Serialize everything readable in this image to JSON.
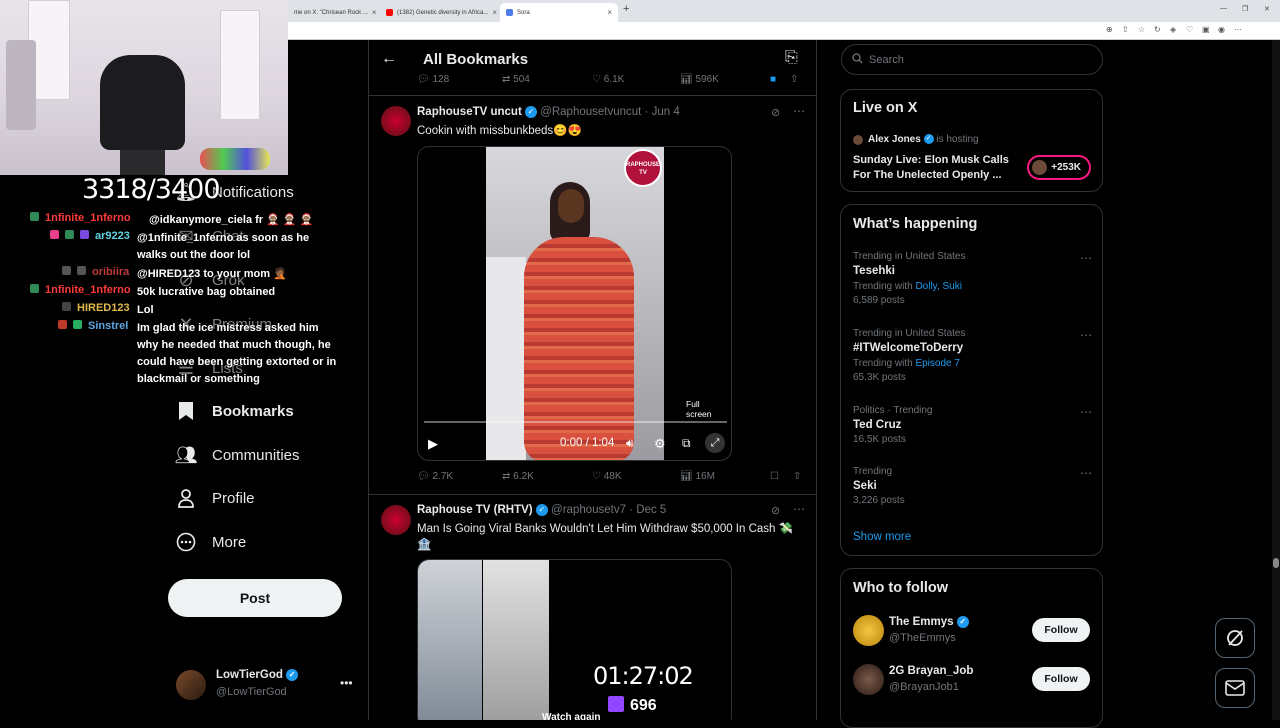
{
  "browser": {
    "tabs": [
      {
        "label": "me on X: \"Chrisean Rock ...",
        "color": "#1d9bf0"
      },
      {
        "label": "(1382) Genetic diversity in Africa...",
        "color": "#ff0000"
      },
      {
        "label": "Sora",
        "color": "#4b7bec"
      }
    ]
  },
  "stream": {
    "counter": "3318/3400",
    "chat": [
      {
        "user": "1nfinite_1nferno",
        "ucolor": "#ff3b3b",
        "msg": "@idkanymore_ciela fr 🤶🏾 🤶🏾 🤶🏾"
      },
      {
        "user": "ar9223",
        "ucolor": "#5fd3e0",
        "msg": "@1nfinite_1nferno as soon as he walks out the door lol"
      },
      {
        "user": "oribiira",
        "ucolor": "#c13b3b",
        "msg": "@HIRED123 to your mom 🤦🏾"
      },
      {
        "user": "1nfinite_1nferno",
        "ucolor": "#ff3b3b",
        "msg": "50k lucrative bag obtained"
      },
      {
        "user": "HIRED123",
        "ucolor": "#e0b94b",
        "msg": "Lol"
      },
      {
        "user": "Sinstrel",
        "ucolor": "#5fa6e0",
        "msg": "Im glad the ice mistress asked him why he needed that much though, he could have been getting extorted or in blackmail or something"
      }
    ]
  },
  "nav": {
    "items": [
      {
        "label": "Notifications"
      },
      {
        "label": "Chat"
      },
      {
        "label": "Grok"
      },
      {
        "label": "Premium"
      },
      {
        "label": "Lists"
      },
      {
        "label": "Bookmarks"
      },
      {
        "label": "Communities"
      },
      {
        "label": "Profile"
      },
      {
        "label": "More"
      }
    ],
    "post_label": "Post",
    "user_name": "LowTierGod",
    "user_handle": "@LowTierGod"
  },
  "header": {
    "title": "All Bookmarks"
  },
  "top_stats": {
    "replies": "128",
    "reposts": "504",
    "likes": "6.1K",
    "views": "596K"
  },
  "tweets": [
    {
      "name": "RaphouseTV uncut",
      "handle": "@Raphousetvuncut",
      "date": "· Jun 4",
      "text": "Cookin with missbunkbeds😊😍",
      "video": {
        "time": "0:00 / 1:04",
        "tooltip": "Full screen",
        "watermark": "RAPHOUSE TV"
      },
      "stats": {
        "replies": "2.7K",
        "reposts": "6.2K",
        "likes": "48K",
        "views": "16M"
      }
    },
    {
      "name": "Raphouse TV (RHTV)",
      "handle": "@raphousetv7",
      "date": "· Dec 5",
      "text": "Man Is Going Viral Banks Wouldn't Let Him Withdraw $50,000 In Cash 💸🏦",
      "video": {
        "overlay_time": "01:27:02",
        "viewer_count": "696",
        "watch_again": "Watch again"
      }
    }
  ],
  "search": {
    "placeholder": "Search"
  },
  "live": {
    "title": "Live on X",
    "host": "Alex Jones",
    "hosting": "is hosting",
    "desc": "Sunday Live: Elon Musk Calls For The Unelected Openly ...",
    "count": "+253K"
  },
  "happening": {
    "title": "What’s happening",
    "trends": [
      {
        "meta": "Trending in United States",
        "name": "Tesehki",
        "with_label": "Trending with",
        "with": "Dolly, Suki",
        "posts": "6,589 posts"
      },
      {
        "meta": "Trending in United States",
        "name": "#ITWelcomeToDerry",
        "with_label": "Trending with",
        "with": "Episode 7",
        "posts": "65.3K posts"
      },
      {
        "meta": "Politics · Trending",
        "name": "Ted Cruz",
        "with_label": "",
        "with": "",
        "posts": "16.5K posts"
      },
      {
        "meta": "Trending",
        "name": "Seki",
        "with_label": "",
        "with": "",
        "posts": "3,226 posts"
      }
    ],
    "show_more": "Show more"
  },
  "who": {
    "title": "Who to follow",
    "accounts": [
      {
        "name": "The Emmys",
        "handle": "@TheEmmys",
        "button": "Follow"
      },
      {
        "name": "2G Brayan_Job",
        "handle": "@BrayanJob1",
        "button": "Follow"
      }
    ]
  },
  "colors": {
    "accent": "#1d9bf0",
    "background": "#000000",
    "border": "#2f3336",
    "live_pink": "#f91880"
  }
}
